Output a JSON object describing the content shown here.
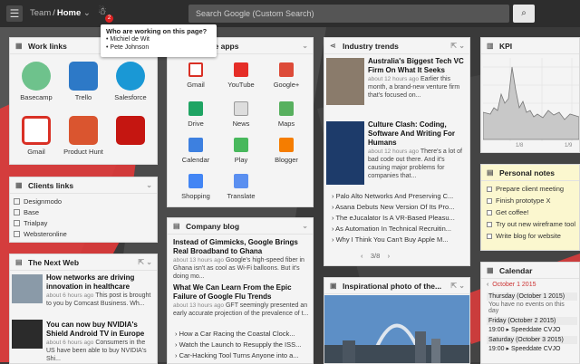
{
  "topbar": {
    "team": "Team",
    "home": "Home",
    "search_placeholder": "Search Google (Custom Search)",
    "badge": "2"
  },
  "tooltip": {
    "title": "Who are working on this page?",
    "users": [
      "• Michiel de Wit",
      "• Pete Johnson"
    ]
  },
  "work_links": {
    "title": "Work links",
    "apps": [
      "Basecamp",
      "Trello",
      "Salesforce",
      "Gmail",
      "Product Hunt",
      "Adobe Reader"
    ]
  },
  "google_apps": {
    "title": "gle apps",
    "apps": [
      "Gmail",
      "YouTube",
      "Google+",
      "Drive",
      "News",
      "Maps",
      "Calendar",
      "Play",
      "Blogger",
      "Shopping",
      "Translate"
    ]
  },
  "clients": {
    "title": "Clients links",
    "items": [
      "Designmodo",
      "Base",
      "Trialpay",
      "Websteronline"
    ]
  },
  "next_web": {
    "title": "The Next Web",
    "items": [
      {
        "title": "How networks are driving innovation in healthcare",
        "meta": "about 6 hours ago",
        "desc": "This post is brought to you by Comcast Business. Wh..."
      },
      {
        "title": "You can now buy NVIDIA's Shield Android TV in Europe",
        "meta": "about 6 hours ago",
        "desc": "Consumers in the US have been able to buy NVIDIA's Shi..."
      }
    ]
  },
  "industry": {
    "title": "Industry trends",
    "items": [
      {
        "title": "Australia's Biggest Tech VC Firm On What It Seeks",
        "meta": "about 12 hours ago",
        "desc": "Earlier this month, a brand-new venture firm that's focused on..."
      },
      {
        "title": "Culture Clash: Coding, Software And Writing For Humans",
        "meta": "about 12 hours ago",
        "desc": "There's a lot of bad code out there. And it's causing major problems for companies that..."
      }
    ],
    "links": [
      "Palo Alto Networks And Preserving C...",
      "Asana Debuts New Version Of Its Pro...",
      "The eJucalator Is A VR-Based Pleasu...",
      "As Automation In Technical Recruitin...",
      "Why I Think You Can't Buy Apple M..."
    ],
    "pager": "3/8"
  },
  "photo": {
    "title": "Inspirational photo of the..."
  },
  "kpi": {
    "title": "KPI",
    "labels": [
      "1/8",
      "1/9"
    ]
  },
  "notes": {
    "title": "Personal notes",
    "items": [
      "Prepare client meeting",
      "Finish prototype X",
      "Get coffee!",
      "Try out new wireframe tool",
      "Write blog for website"
    ]
  },
  "blog": {
    "title": "Company blog",
    "items": [
      {
        "title": "Instead of Gimmicks, Google Brings Real Broadband to Ghana",
        "meta": "about 13 hours ago",
        "desc": "Google's high-speed fiber in Ghana isn't as cool as Wi-Fi balloons. But it's doing mo..."
      },
      {
        "title": "What We Can Learn From the Epic Failure of Google Flu Trends",
        "meta": "about 13 hours ago",
        "desc": "GFT seemingly presented an early accurate projection of the prevalence of t..."
      }
    ],
    "links": [
      "How a Car Racing the Coastal Clock...",
      "Watch the Launch to Resupply the ISS...",
      "Car-Hacking Tool Turns Anyone into a..."
    ]
  },
  "calendar": {
    "title": "Calendar",
    "month": "October 1 2015",
    "days": [
      {
        "label": "Thursday (October 1 2015)",
        "event": "You have no events on this day"
      },
      {
        "label": "Friday (October 2 2015)",
        "event": "Speeddate CVJO"
      },
      {
        "label": "Saturday (October 3 2015)",
        "event": "Speeddate CVJO"
      }
    ],
    "time": "19:00"
  },
  "colors": {
    "accent": "#e23b3b",
    "notes_bg": "#fbf7cf"
  }
}
